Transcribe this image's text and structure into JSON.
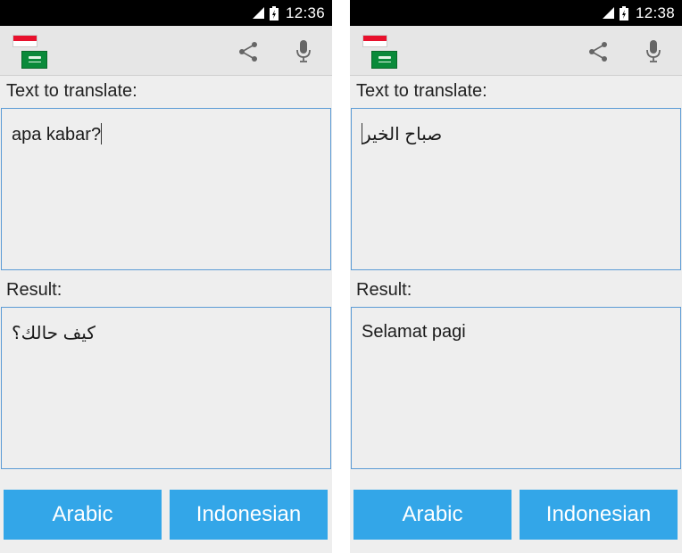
{
  "screens": [
    {
      "status": {
        "time": "12:36"
      },
      "source_label": "Text to translate:",
      "source_text": "apa kabar?",
      "result_label": "Result:",
      "result_text": "كيف حالك؟",
      "buttons": {
        "arabic": "Arabic",
        "indonesian": "Indonesian"
      }
    },
    {
      "status": {
        "time": "12:38"
      },
      "source_label": "Text to translate:",
      "source_text": "صباح الخير",
      "result_label": "Result:",
      "result_text": "Selamat pagi",
      "buttons": {
        "arabic": "Arabic",
        "indonesian": "Indonesian"
      }
    }
  ],
  "colors": {
    "button_bg": "#33a6e8",
    "field_border": "#5b9bd5",
    "status_bar": "#000000",
    "action_bar": "#e6e6e6",
    "background": "#eeeeee"
  },
  "icons": [
    "signal-icon",
    "battery-icon",
    "indonesia-flag-icon",
    "saudi-flag-icon",
    "share-icon",
    "microphone-icon"
  ]
}
